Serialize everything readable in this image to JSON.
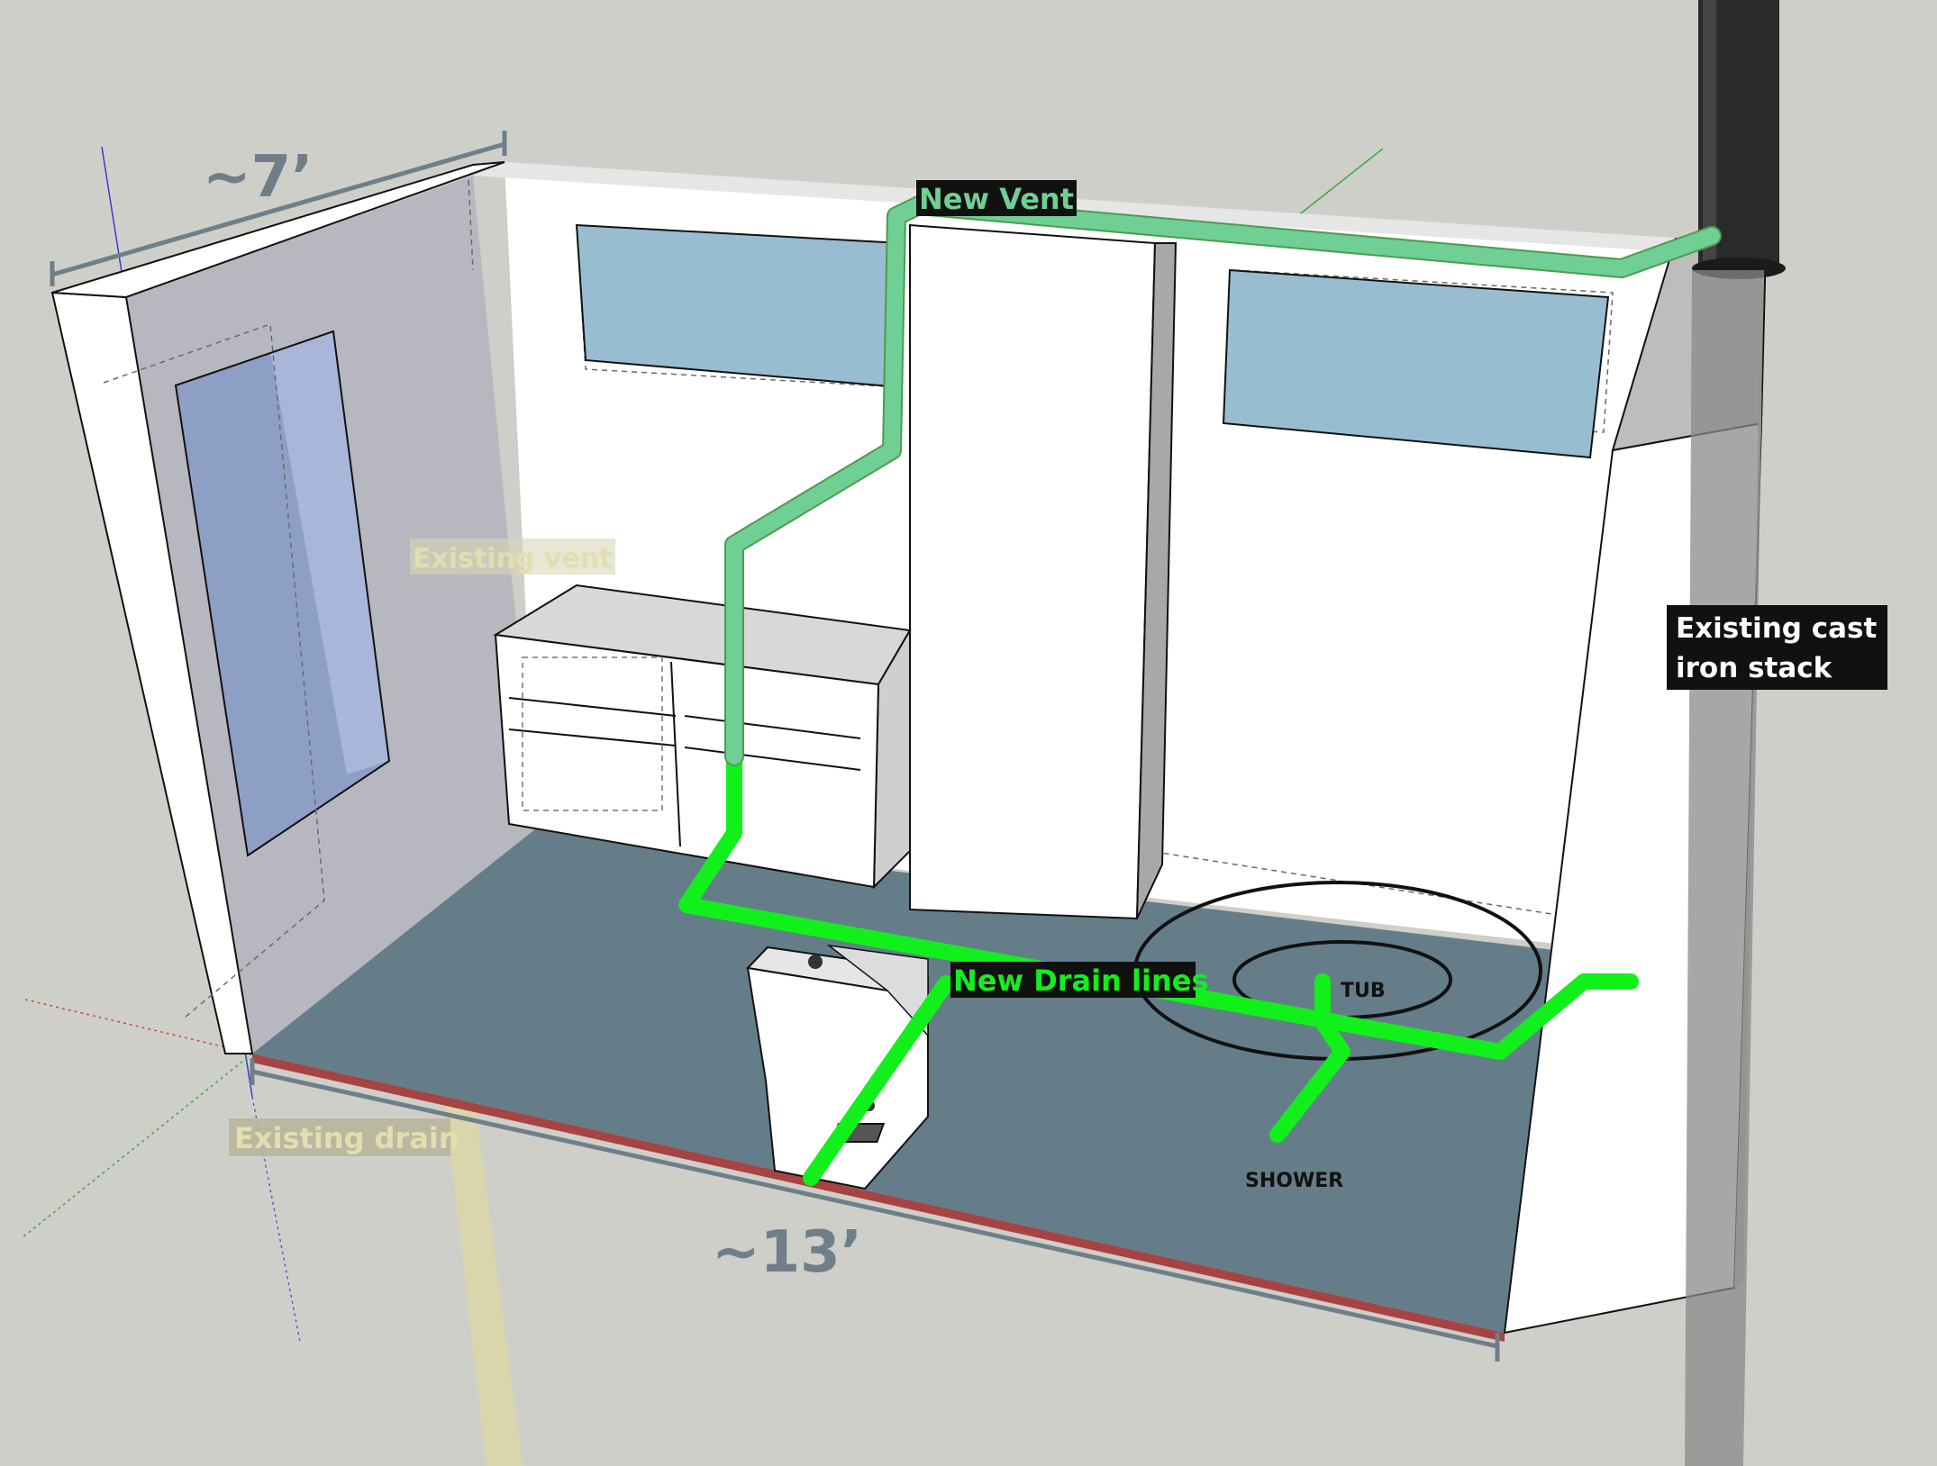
{
  "dimensions": {
    "width_label": "~7’",
    "length_label": "~13’"
  },
  "labels": {
    "new_vent": "New Vent",
    "existing_vent": "Existing vent",
    "existing_stack": [
      "Existing cast",
      "iron stack"
    ],
    "new_drain_lines": "New Drain lines",
    "existing_drain": "Existing drain",
    "tub": "TUB",
    "shower": "SHOWER"
  },
  "colors": {
    "new_vent": "#6fcf94",
    "new_drain": "#12f01c",
    "existing_pipe": "#ddd8a0",
    "cast_iron": "#2a2a2a",
    "floor": "#647d89",
    "window_glass": "#98bdd1",
    "dimension_line": "#6f7f89",
    "background": "#cfcfca"
  }
}
